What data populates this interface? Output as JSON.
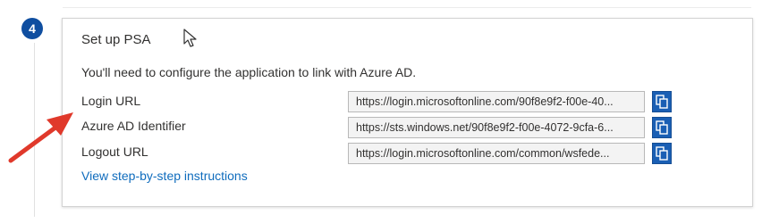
{
  "step": {
    "number": "4"
  },
  "section": {
    "title": "Set up PSA",
    "description": "You'll need to configure the application to link with Azure AD."
  },
  "fields": [
    {
      "label": "Login URL",
      "value": "https://login.microsoftonline.com/90f8e9f2-f00e-40..."
    },
    {
      "label": "Azure AD Identifier",
      "value": "https://sts.windows.net/90f8e9f2-f00e-4072-9cfa-6..."
    },
    {
      "label": "Logout URL",
      "value": "https://login.microsoftonline.com/common/wsfede..."
    }
  ],
  "link": {
    "label": "View step-by-step instructions"
  },
  "icons": {
    "copy": "copy-icon",
    "cursor": "mouse-pointer-icon",
    "annotation": "red-arrow-icon"
  },
  "colors": {
    "badge": "#0f4ea0",
    "copy_button": "#1a5fb4",
    "link": "#0f6cbd",
    "arrow": "#e0392b"
  }
}
